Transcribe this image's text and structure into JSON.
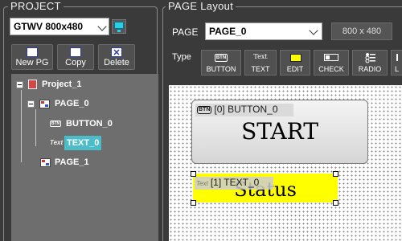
{
  "project": {
    "title": "PROJECT",
    "model": "GTWV 800x480",
    "toolbar": {
      "new_label": "New PG",
      "copy_label": "Copy",
      "delete_label": "Delete"
    },
    "tree": {
      "root": "Project_1",
      "page0": "PAGE_0",
      "button0": "BUTTON_0",
      "text0": "TEXT_0",
      "page1": "PAGE_1",
      "button_badge": "BTN",
      "text_badge": "Text"
    }
  },
  "layout": {
    "title": "PAGE Layout",
    "page_label": "PAGE",
    "page_value": "PAGE_0",
    "resolution": "800 x 480",
    "type_label": "Type",
    "types": {
      "button": "BUTTON",
      "text": "TEXT",
      "edit": "EDIT",
      "check": "CHECK",
      "radio": "RADIO",
      "more": "L"
    },
    "type_icons": {
      "button": "BTN",
      "text": "Text",
      "edit": "EDIT"
    }
  },
  "canvas": {
    "button_widget": {
      "tag_badge": "BTN",
      "tag": "[0] BUTTON_0",
      "caption": "START"
    },
    "text_widget": {
      "tag_badge": "Text",
      "tag": "[1] TEXT_0",
      "caption": "Status",
      "fill": "#ffff00"
    }
  },
  "colors": {
    "panel_bg": "#3a3a3a",
    "tree_bg": "#6e6e6e",
    "selected_node": "#4cbcc8",
    "monitor_icon": "#26d0e8"
  }
}
